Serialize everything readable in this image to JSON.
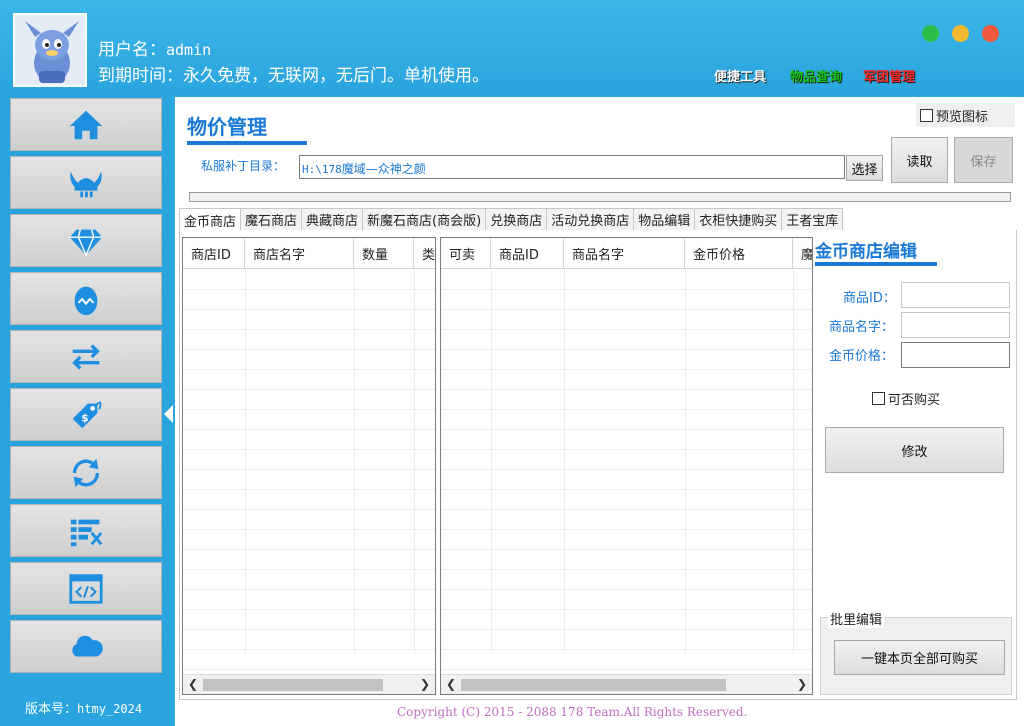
{
  "user": {
    "name_label": "用户名：",
    "name_value": "admin",
    "expiry_label": "到期时间：",
    "expiry_value": "永久免费，无联网，无后门。单机使用。"
  },
  "header_links": [
    {
      "label": "便捷工具",
      "color": "#ffffff"
    },
    {
      "label": "物品查询",
      "color": "#16c21a"
    },
    {
      "label": "军团管理",
      "color": "#ff2a2a"
    }
  ],
  "window_dots": [
    {
      "name": "minimize",
      "color": "#2bbf4a"
    },
    {
      "name": "maximize",
      "color": "#f2b830"
    },
    {
      "name": "close",
      "color": "#f05a3a"
    }
  ],
  "sidebar": {
    "items": [
      {
        "icon": "home-icon"
      },
      {
        "icon": "viking-helmet-icon"
      },
      {
        "icon": "diamond-icon"
      },
      {
        "icon": "egg-icon"
      },
      {
        "icon": "exchange-arrows-icon"
      },
      {
        "icon": "price-tag-icon"
      },
      {
        "icon": "refresh-icon"
      },
      {
        "icon": "list-settings-icon"
      },
      {
        "icon": "code-window-icon"
      },
      {
        "icon": "cloud-icon"
      }
    ],
    "active_index": 5,
    "version_label": "版本号：",
    "version_value": "htmy_2024"
  },
  "page": {
    "title": "物价管理",
    "preview_icon_label": "预览图标",
    "path_label": "私服补丁目录：",
    "path_value_prefix": "H:\\178",
    "path_value_suffix": "魔域—众神之颜",
    "select_button": "选择",
    "read_button": "读取",
    "save_button": "保存"
  },
  "tabs": [
    "金币商店",
    "魔石商店",
    "典藏商店",
    "新魔石商店(商会版)",
    "兑换商店",
    "活动兑换商店",
    "物品编辑",
    "衣柜快捷购买",
    "王者宝库"
  ],
  "active_tab": 0,
  "shop_grid": {
    "columns": [
      "商店ID",
      "商店名字",
      "数量",
      "类"
    ]
  },
  "item_grid": {
    "columns": [
      "可卖",
      "商品ID",
      "商品名字",
      "金币价格",
      "魔"
    ]
  },
  "edit_panel": {
    "title": "金币商店编辑",
    "item_id_label": "商品ID：",
    "item_name_label": "商品名字：",
    "gold_price_label": "金币价格：",
    "buyable_label": "可否购买",
    "modify_button": "修改",
    "batch_label": "批里编辑",
    "batch_button": "一键本页全部可购买"
  },
  "copyright": "Copyright (C) 2015 - 2088 178 Team.All Rights Reserved."
}
